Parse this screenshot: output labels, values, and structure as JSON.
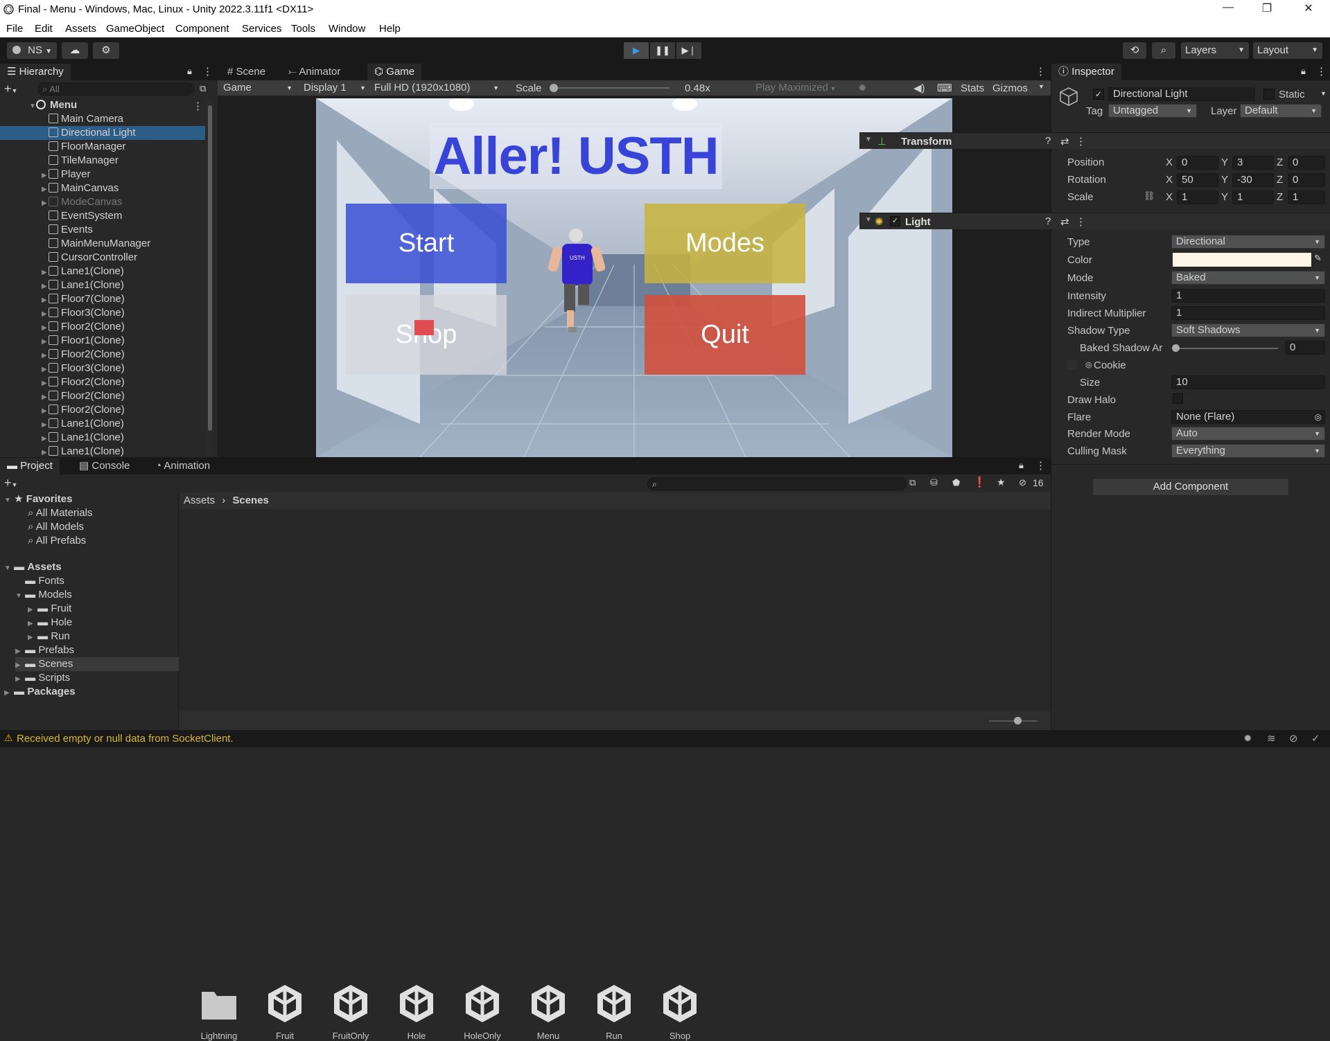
{
  "window": {
    "title": "Final - Menu - Windows, Mac, Linux - Unity 2022.3.11f1 <DX11>",
    "minimize": "—",
    "maximize": "❐",
    "close": "✕"
  },
  "menu": [
    "File",
    "Edit",
    "Assets",
    "GameObject",
    "Component",
    "Services",
    "Tools",
    "Window",
    "Help"
  ],
  "toolbar": {
    "account": "NS",
    "layers": "Layers",
    "layout": "Layout"
  },
  "hierarchy": {
    "tab": "Hierarchy",
    "search_placeholder": "All",
    "scene": "Menu",
    "items": [
      {
        "name": "Main Camera",
        "expand": false,
        "sel": false,
        "dim": false
      },
      {
        "name": "Directional Light",
        "expand": false,
        "sel": true,
        "dim": false
      },
      {
        "name": "FloorManager",
        "expand": false,
        "sel": false,
        "dim": false
      },
      {
        "name": "TileManager",
        "expand": false,
        "sel": false,
        "dim": false
      },
      {
        "name": "Player",
        "expand": true,
        "sel": false,
        "dim": false
      },
      {
        "name": "MainCanvas",
        "expand": true,
        "sel": false,
        "dim": false
      },
      {
        "name": "ModeCanvas",
        "expand": true,
        "sel": false,
        "dim": true
      },
      {
        "name": "EventSystem",
        "expand": false,
        "sel": false,
        "dim": false
      },
      {
        "name": "Events",
        "expand": false,
        "sel": false,
        "dim": false
      },
      {
        "name": "MainMenuManager",
        "expand": false,
        "sel": false,
        "dim": false
      },
      {
        "name": "CursorController",
        "expand": false,
        "sel": false,
        "dim": false
      },
      {
        "name": "Lane1(Clone)",
        "expand": true,
        "sel": false,
        "dim": false
      },
      {
        "name": "Lane1(Clone)",
        "expand": true,
        "sel": false,
        "dim": false
      },
      {
        "name": "Floor7(Clone)",
        "expand": true,
        "sel": false,
        "dim": false
      },
      {
        "name": "Floor3(Clone)",
        "expand": true,
        "sel": false,
        "dim": false
      },
      {
        "name": "Floor2(Clone)",
        "expand": true,
        "sel": false,
        "dim": false
      },
      {
        "name": "Floor1(Clone)",
        "expand": true,
        "sel": false,
        "dim": false
      },
      {
        "name": "Floor2(Clone)",
        "expand": true,
        "sel": false,
        "dim": false
      },
      {
        "name": "Floor3(Clone)",
        "expand": true,
        "sel": false,
        "dim": false
      },
      {
        "name": "Floor2(Clone)",
        "expand": true,
        "sel": false,
        "dim": false
      },
      {
        "name": "Floor2(Clone)",
        "expand": true,
        "sel": false,
        "dim": false
      },
      {
        "name": "Floor2(Clone)",
        "expand": true,
        "sel": false,
        "dim": false
      },
      {
        "name": "Lane1(Clone)",
        "expand": true,
        "sel": false,
        "dim": false
      },
      {
        "name": "Lane1(Clone)",
        "expand": true,
        "sel": false,
        "dim": false
      },
      {
        "name": "Lane1(Clone)",
        "expand": true,
        "sel": false,
        "dim": false
      }
    ]
  },
  "views": {
    "tabs": [
      "Scene",
      "Animator",
      "Game"
    ],
    "game": "Game",
    "display": "Display 1",
    "resolution": "Full HD (1920x1080)",
    "scale_label": "Scale",
    "scale": "0.48x",
    "scale_level": 0.02,
    "play_maximized": "Play Maximized",
    "stats": "Stats",
    "gizmos": "Gizmos"
  },
  "game": {
    "title": "Aller! USTH",
    "start": "Start",
    "modes": "Modes",
    "shop": "Shop",
    "quit": "Quit",
    "shirt": "USTH"
  },
  "inspector": {
    "tab": "Inspector",
    "object_name": "Directional Light",
    "static": "Static",
    "tag_label": "Tag",
    "tag": "Untagged",
    "layer_label": "Layer",
    "layer": "Default",
    "transform": {
      "title": "Transform",
      "rows": [
        {
          "label": "Position",
          "x": "0",
          "y": "3",
          "z": "0"
        },
        {
          "label": "Rotation",
          "x": "50",
          "y": "-30",
          "z": "0"
        },
        {
          "label": "Scale",
          "x": "1",
          "y": "1",
          "z": "1"
        }
      ],
      "x": "X",
      "y": "Y",
      "z": "Z"
    },
    "light": {
      "title": "Light",
      "type_label": "Type",
      "type": "Directional",
      "color_label": "Color",
      "color": "#fdf5e6",
      "mode_label": "Mode",
      "mode": "Baked",
      "intensity_label": "Intensity",
      "intensity": "1",
      "indirect_label": "Indirect Multiplier",
      "indirect": "1",
      "shadow_label": "Shadow Type",
      "shadow": "Soft Shadows",
      "baked_label": "Baked Shadow Ar",
      "baked": "0",
      "baked_level": 0,
      "cookie_label": "Cookie",
      "size_label": "Size",
      "size": "10",
      "halo_label": "Draw Halo",
      "flare_label": "Flare",
      "flare": "None (Flare)",
      "render_label": "Render Mode",
      "render": "Auto",
      "culling_label": "Culling Mask",
      "culling": "Everything"
    },
    "add_component": "Add Component"
  },
  "project": {
    "tabs": [
      "Project",
      "Console",
      "Animation"
    ],
    "hidden_count": "16",
    "favorites": "Favorites",
    "fav_items": [
      "All Materials",
      "All Models",
      "All Prefabs"
    ],
    "assets": "Assets",
    "tree": [
      {
        "name": "Fonts",
        "level": 1,
        "expand": false
      },
      {
        "name": "Models",
        "level": 1,
        "expand": true
      },
      {
        "name": "Fruit",
        "level": 2,
        "expand": true
      },
      {
        "name": "Hole",
        "level": 2,
        "expand": true
      },
      {
        "name": "Run",
        "level": 2,
        "expand": true
      },
      {
        "name": "Prefabs",
        "level": 1,
        "expand": true
      },
      {
        "name": "Scenes",
        "level": 1,
        "expand": true
      },
      {
        "name": "Scripts",
        "level": 1,
        "expand": true
      }
    ],
    "packages": "Packages",
    "breadcrumb": [
      "Assets",
      "Scenes"
    ],
    "files": [
      "Lightning",
      "Fruit",
      "FruitOnly",
      "Hole",
      "HoleOnly",
      "Menu",
      "Run",
      "Shop"
    ]
  },
  "status": {
    "message": "Received empty or null data from SocketClient."
  },
  "colors": {
    "start": "#3a4fd6",
    "modes": "#c8b43c",
    "shop": "#d0d0d4",
    "quit": "#d2503c",
    "title": "#3843d8",
    "selection": "#2c5d87"
  }
}
